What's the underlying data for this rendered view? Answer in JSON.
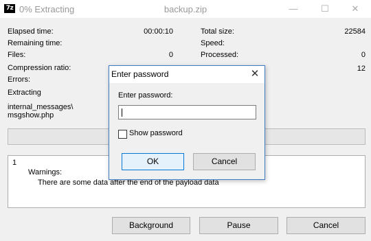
{
  "window": {
    "app_title": "0% Extracting",
    "file_title": "backup.zip",
    "app_icon_text": "7z",
    "minimize_glyph": "—",
    "maximize_glyph": "☐",
    "close_glyph": "✕"
  },
  "stats": {
    "elapsed_label": "Elapsed time:",
    "elapsed_value": "00:00:10",
    "remaining_label": "Remaining time:",
    "files_label": "Files:",
    "files_value": "0",
    "compression_label": "Compression ratio:",
    "errors_label": "Errors:",
    "total_size_label": "Total size:",
    "total_size_value": "22584",
    "speed_label": "Speed:",
    "processed_label": "Processed:",
    "processed_value": "0",
    "right_partial_value": "12"
  },
  "current": {
    "action": "Extracting",
    "path_line1": "internal_messages\\",
    "path_line2": "msgshow.php"
  },
  "log": {
    "row_number": "1",
    "warnings_label": "Warnings:",
    "message": "There are some data after the end of the payload data"
  },
  "progress": {
    "percent": 0
  },
  "buttons": {
    "background": "Background",
    "pause": "Pause",
    "cancel": "Cancel"
  },
  "dialog": {
    "title": "Enter password",
    "close_glyph": "✕",
    "prompt": "Enter password:",
    "password_value": "",
    "show_password_label": "Show password",
    "show_password_checked": false,
    "ok_label": "OK",
    "cancel_label": "Cancel"
  },
  "colors": {
    "accent": "#0078d7",
    "dialog_border": "#3b7bbf",
    "background": "#f0f0f0"
  }
}
